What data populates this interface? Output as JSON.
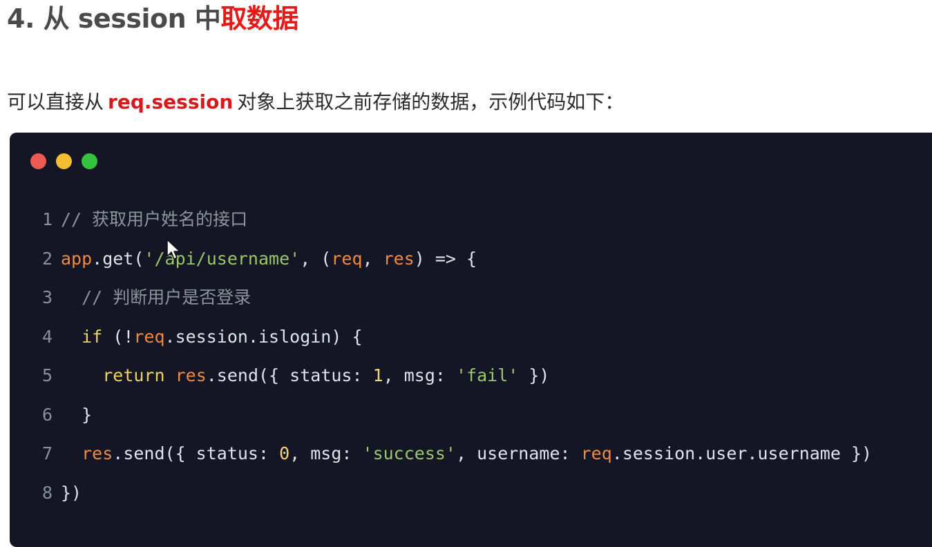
{
  "heading": {
    "number": "4.",
    "plain": " 从 session 中",
    "accent": "取数据"
  },
  "paragraph": {
    "before": "可以直接从",
    "code": "req.session",
    "after": "对象上获取之前存储的数据，示例代码如下："
  },
  "window_controls": {
    "red": "#ee5a52",
    "yellow": "#f5be31",
    "green": "#37c23d"
  },
  "code_lines": [
    {
      "n": "1",
      "tokens": [
        [
          "comment",
          "// 获取用户姓名的接口"
        ]
      ]
    },
    {
      "n": "2",
      "tokens": [
        [
          "obj",
          "app"
        ],
        [
          "plain",
          ".get("
        ],
        [
          "str",
          "'/api/username'"
        ],
        [
          "plain",
          ", ("
        ],
        [
          "obj",
          "req"
        ],
        [
          "plain",
          ", "
        ],
        [
          "obj",
          "res"
        ],
        [
          "plain",
          ") => {"
        ]
      ]
    },
    {
      "n": "3",
      "tokens": [
        [
          "plain",
          "  "
        ],
        [
          "comment",
          "// 判断用户是否登录"
        ]
      ]
    },
    {
      "n": "4",
      "tokens": [
        [
          "plain",
          "  "
        ],
        [
          "kw",
          "if"
        ],
        [
          "plain",
          " (!"
        ],
        [
          "obj",
          "req"
        ],
        [
          "plain",
          ".session.islogin) {"
        ]
      ]
    },
    {
      "n": "5",
      "tokens": [
        [
          "plain",
          "    "
        ],
        [
          "kw",
          "return"
        ],
        [
          "plain",
          " "
        ],
        [
          "obj",
          "res"
        ],
        [
          "plain",
          ".send({ status: "
        ],
        [
          "num",
          "1"
        ],
        [
          "plain",
          ", msg: "
        ],
        [
          "str",
          "'fail'"
        ],
        [
          "plain",
          " })"
        ]
      ]
    },
    {
      "n": "6",
      "tokens": [
        [
          "plain",
          "  }"
        ]
      ]
    },
    {
      "n": "7",
      "tokens": [
        [
          "plain",
          "  "
        ],
        [
          "obj",
          "res"
        ],
        [
          "plain",
          ".send({ status: "
        ],
        [
          "num",
          "0"
        ],
        [
          "plain",
          ", msg: "
        ],
        [
          "str",
          "'success'"
        ],
        [
          "plain",
          ", username: "
        ],
        [
          "obj",
          "req"
        ],
        [
          "plain",
          ".session.user.username })"
        ]
      ]
    },
    {
      "n": "8",
      "tokens": [
        [
          "plain",
          "})"
        ]
      ]
    }
  ]
}
